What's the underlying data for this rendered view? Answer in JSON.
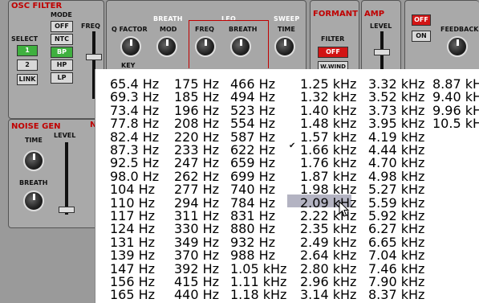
{
  "osc_panel": {
    "title": "OSC FILTER",
    "mode_label": "MODE",
    "select_label": "SELECT",
    "freq_label": "FREQ",
    "buttons": {
      "off": "OFF",
      "ntc": "NTC",
      "bp": "BP",
      "hp": "HP",
      "lp": "LP",
      "one": "1",
      "two": "2",
      "link": "LINK"
    }
  },
  "mid_panel": {
    "q_factor": "Q FACTOR",
    "breath": "BREATH",
    "mod": "MOD",
    "lfo": "LFO",
    "lfo_freq": "FREQ",
    "lfo_breath": "BREATH",
    "sweep": "SWEEP",
    "time": "TIME",
    "key": "KEY"
  },
  "formant_panel": {
    "title": "FORMANT",
    "filter": "FILTER",
    "off": "OFF",
    "wind": "W.WIND"
  },
  "amp_panel": {
    "title": "AMP",
    "level": "LEVEL"
  },
  "feedback_panel": {
    "off": "OFF",
    "on": "ON",
    "feedback": "FEEDBACK"
  },
  "noise_panel": {
    "title": "NOISE GEN",
    "time": "TIME",
    "level": "LEVEL",
    "breath": "BREATH",
    "partial_title": "N"
  },
  "frequency_menu": {
    "columns": [
      [
        "65.4 Hz",
        "69.3 Hz",
        "73.4 Hz",
        "77.8 Hz",
        "82.4 Hz",
        "87.3 Hz",
        "92.5 Hz",
        "98.0 Hz",
        "104 Hz",
        "110 Hz",
        "117 Hz",
        "124 Hz",
        "131 Hz",
        "139 Hz",
        "147 Hz",
        "156 Hz",
        "165 Hz"
      ],
      [
        "175 Hz",
        "185 Hz",
        "196 Hz",
        "208 Hz",
        "220 Hz",
        "233 Hz",
        "247 Hz",
        "262 Hz",
        "277 Hz",
        "294 Hz",
        "311 Hz",
        "330 Hz",
        "349 Hz",
        "370 Hz",
        "392 Hz",
        "415 Hz",
        "440 Hz"
      ],
      [
        "466 Hz",
        "494 Hz",
        "523 Hz",
        "554 Hz",
        "587 Hz",
        "622 Hz",
        "659 Hz",
        "699 Hz",
        "740 Hz",
        "784 Hz",
        "831 Hz",
        "880 Hz",
        "932 Hz",
        "988 Hz",
        "1.05 kHz",
        "1.11 kHz",
        "1.18 kHz"
      ],
      [
        "1.25 kHz",
        "1.32 kHz",
        "1.40 kHz",
        "1.48 kHz",
        "1.57 kHz",
        "1.66 kHz",
        "1.76 kHz",
        "1.87 kHz",
        "1.98 kHz",
        "2.09 kHz",
        "2.22 kHz",
        "2.35 kHz",
        "2.49 kHz",
        "2.64 kHz",
        "2.80 kHz",
        "2.96 kHz",
        "3.14 kHz"
      ],
      [
        "3.32 kHz",
        "3.52 kHz",
        "3.73 kHz",
        "3.95 kHz",
        "4.19 kHz",
        "4.44 kHz",
        "4.70 kHz",
        "4.98 kHz",
        "5.27 kHz",
        "5.59 kHz",
        "5.92 kHz",
        "6.27 kHz",
        "6.65 kHz",
        "7.04 kHz",
        "7.46 kHz",
        "7.90 kHz",
        "8.37 kHz"
      ],
      [
        "8.87 kHz",
        "9.40 kHz",
        "9.96 kHz",
        "10.5 kHz"
      ]
    ],
    "checked_item": "1.66 kHz",
    "hovered_item": "2.09 kHz",
    "check_glyph": "✔"
  }
}
